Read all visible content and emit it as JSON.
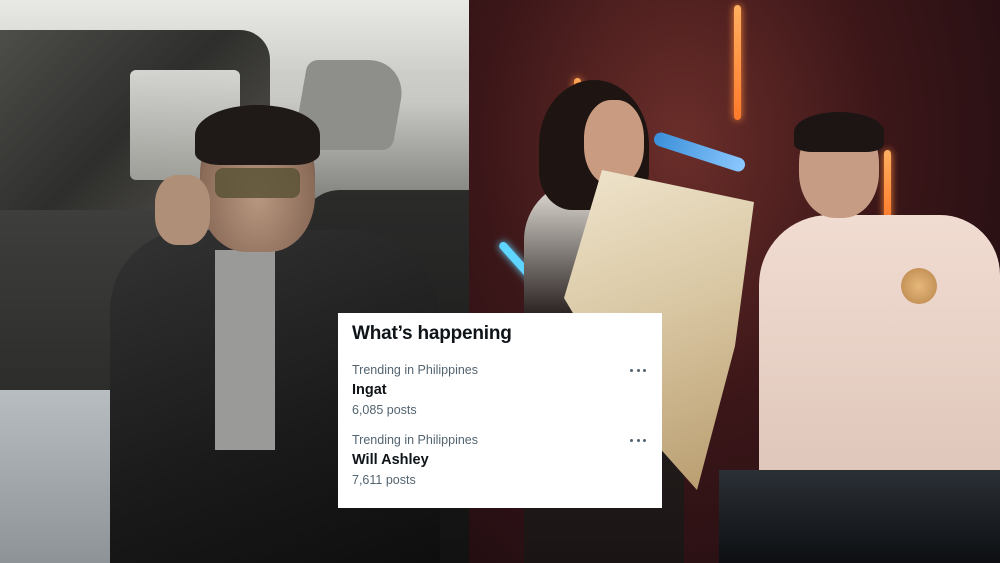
{
  "trends_card": {
    "title": "What’s happening",
    "trends": [
      {
        "context": "Trending in Philippines",
        "name": "Ingat",
        "post_count": "6,085 posts",
        "more_icon": "more-horizontal-icon"
      },
      {
        "context": "Trending in Philippines",
        "name": "Will Ashley",
        "post_count": "7,611 posts",
        "more_icon": "more-horizontal-icon"
      }
    ]
  },
  "colors": {
    "card_bg": "#ffffff",
    "primary_text": "#0f1419",
    "secondary_text": "#536471"
  }
}
